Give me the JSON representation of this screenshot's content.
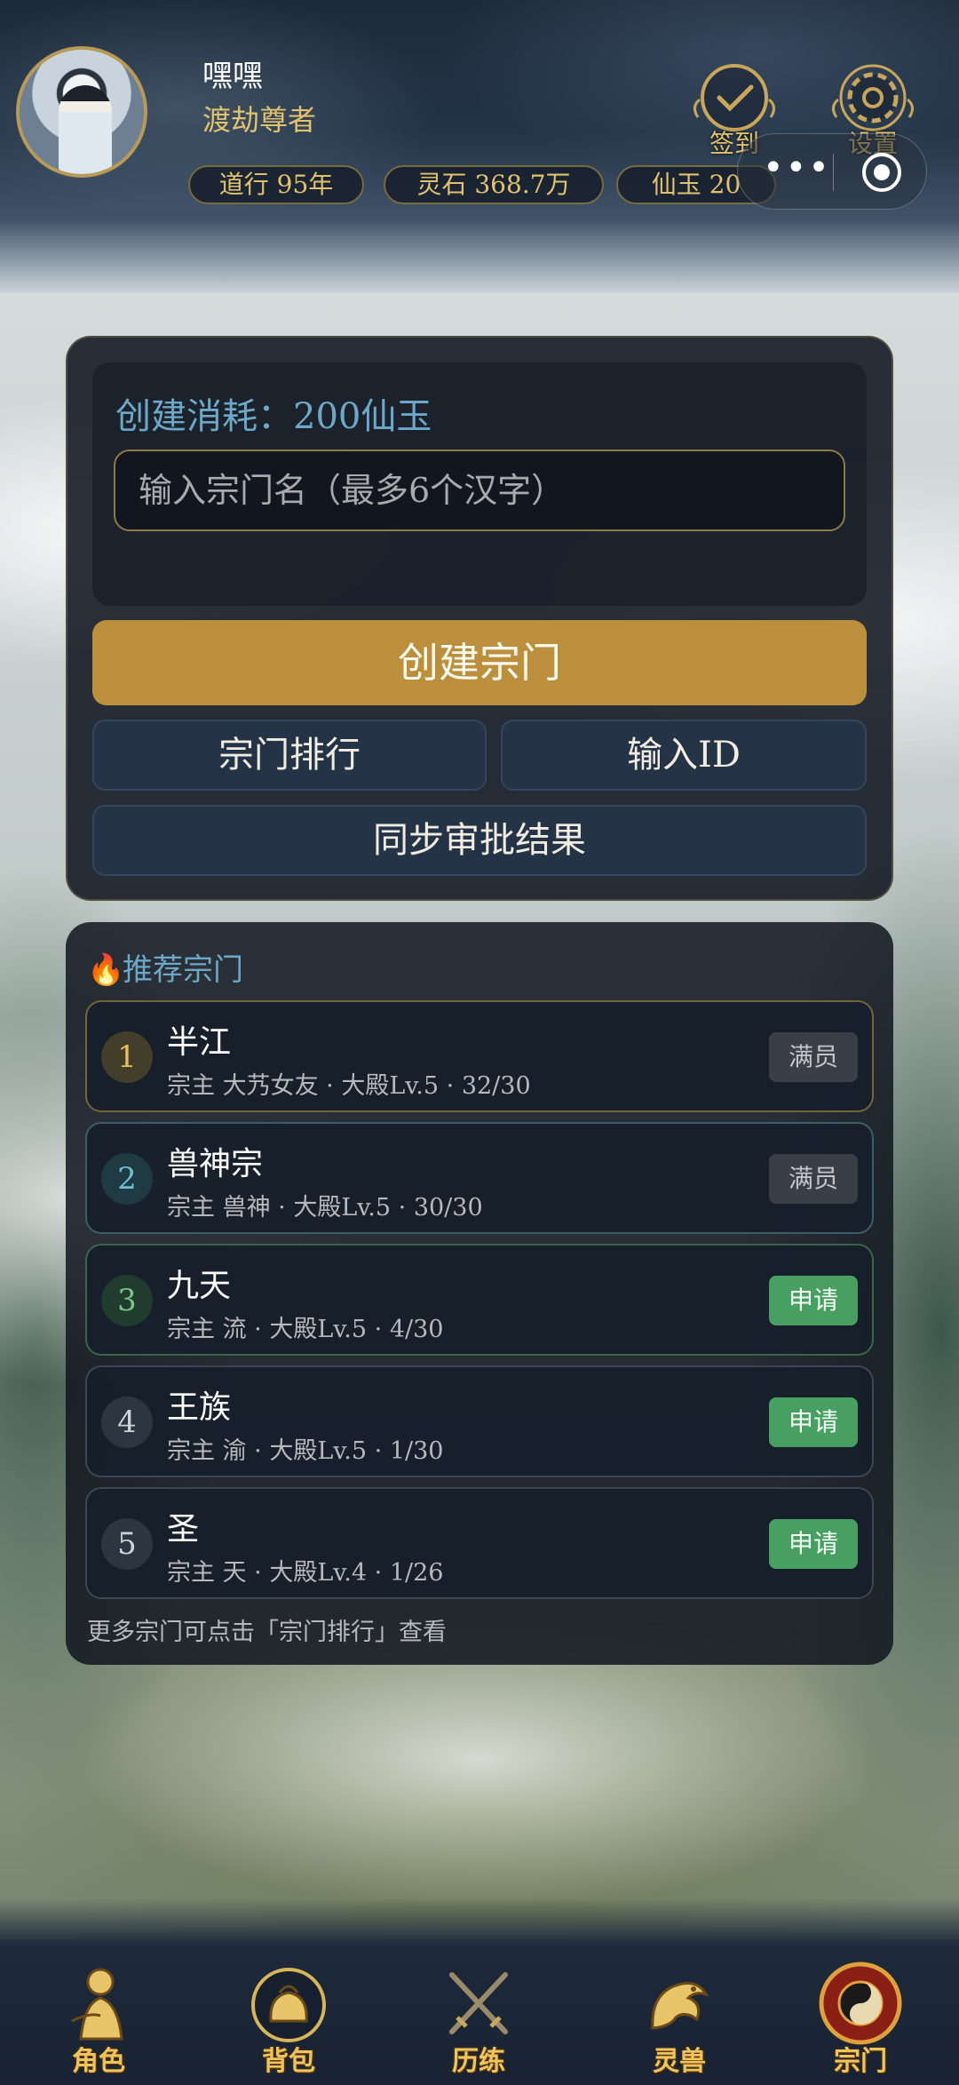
{
  "player": {
    "name": "嘿嘿",
    "title": "渡劫尊者"
  },
  "resources": [
    {
      "id": "daoxing",
      "text": "道行 95年"
    },
    {
      "id": "lingshi",
      "text": "灵石 368.7万"
    },
    {
      "id": "xianyu",
      "text": "仙玉 20"
    }
  ],
  "top_buttons": {
    "checkin": "签到",
    "settings": "设置"
  },
  "create": {
    "cost_label": "创建消耗：200仙玉",
    "name_placeholder": "输入宗门名（最多6个汉字）",
    "create_button": "创建宗门",
    "ranking_button": "宗门排行",
    "input_id_button": "输入ID",
    "sync_button": "同步审批结果"
  },
  "recommended": {
    "header": "推荐宗门",
    "sects": [
      {
        "rank": "1",
        "name": "半江",
        "info": "宗主 大艿女友 · 大殿Lv.5 · 32/30",
        "status": "满员"
      },
      {
        "rank": "2",
        "name": "兽神宗",
        "info": "宗主 兽神 · 大殿Lv.5 · 30/30",
        "status": "满员"
      },
      {
        "rank": "3",
        "name": "九天",
        "info": "宗主 流 · 大殿Lv.5 · 4/30",
        "status": "申请"
      },
      {
        "rank": "4",
        "name": "王族",
        "info": "宗主 渝 · 大殿Lv.5 · 1/30",
        "status": "申请"
      },
      {
        "rank": "5",
        "name": "圣",
        "info": "宗主 天 · 大殿Lv.4 · 1/26",
        "status": "申请"
      }
    ],
    "footnote": "更多宗门可点击「宗门排行」查看"
  },
  "bottom_nav": [
    {
      "id": "character",
      "label": "角色",
      "icon": "character-icon"
    },
    {
      "id": "bag",
      "label": "背包",
      "icon": "bag-icon"
    },
    {
      "id": "training",
      "label": "历练",
      "icon": "crossed-swords-icon"
    },
    {
      "id": "beast",
      "label": "灵兽",
      "icon": "dragon-icon"
    },
    {
      "id": "sect",
      "label": "宗门",
      "icon": "taiji-icon"
    }
  ],
  "colors": {
    "gold": "#e2c26c",
    "create_button": "#bb8f3b",
    "apply_green": "#47a061",
    "accent_blue": "#6ea8c8"
  }
}
